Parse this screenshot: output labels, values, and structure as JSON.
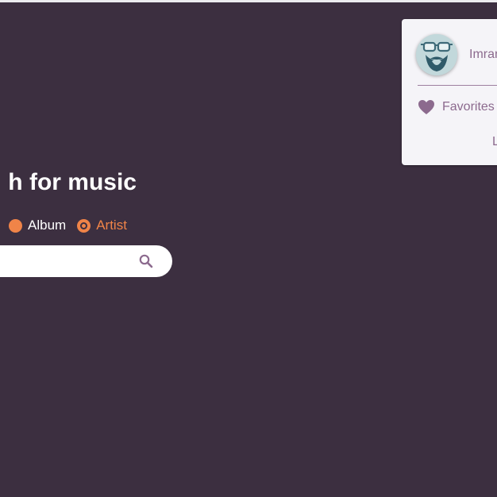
{
  "header": {
    "title": "h for music"
  },
  "search": {
    "radios": [
      {
        "label": "Album",
        "selected": false
      },
      {
        "label": "Artist",
        "selected": true
      }
    ],
    "input_value": "",
    "placeholder": "",
    "icon": "search-icon"
  },
  "user_menu": {
    "name": "Imran",
    "avatar_icon": "bearded-glasses-avatar",
    "favorites_label": "Favorites",
    "favorites_icon": "heart-icon",
    "logout_label": "L"
  },
  "colors": {
    "background": "#3c2f40",
    "accent": "#f08448",
    "card": "#f5f4f8",
    "muted_purple": "#8c6a8e"
  }
}
